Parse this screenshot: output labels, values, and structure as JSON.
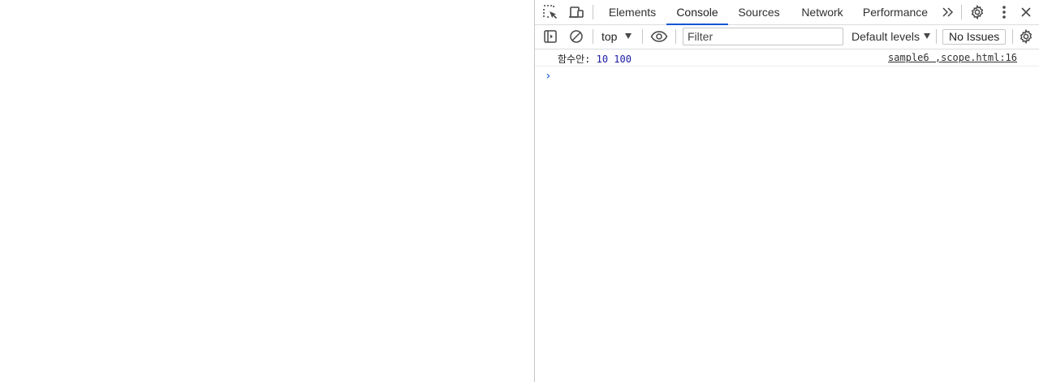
{
  "devtools": {
    "tabs": [
      {
        "label": "Elements",
        "active": false
      },
      {
        "label": "Console",
        "active": true
      },
      {
        "label": "Sources",
        "active": false
      },
      {
        "label": "Network",
        "active": false
      },
      {
        "label": "Performance",
        "active": false
      }
    ],
    "icons": {
      "inspect": "inspect-element-icon",
      "device": "device-toolbar-icon",
      "more_tabs": "chevron-double-right-icon",
      "settings": "gear-icon",
      "menu": "vertical-dots-icon",
      "close": "close-icon"
    },
    "accent_color": "#0b57d0"
  },
  "console_toolbar": {
    "context": "top",
    "filter_placeholder": "Filter",
    "levels_label": "Default levels",
    "issues_label": "No Issues"
  },
  "console": {
    "messages": [
      {
        "label": "함수안:",
        "values": "10 100",
        "source": "sample6 ,scope.html:16"
      }
    ],
    "prompt_symbol": "›"
  }
}
